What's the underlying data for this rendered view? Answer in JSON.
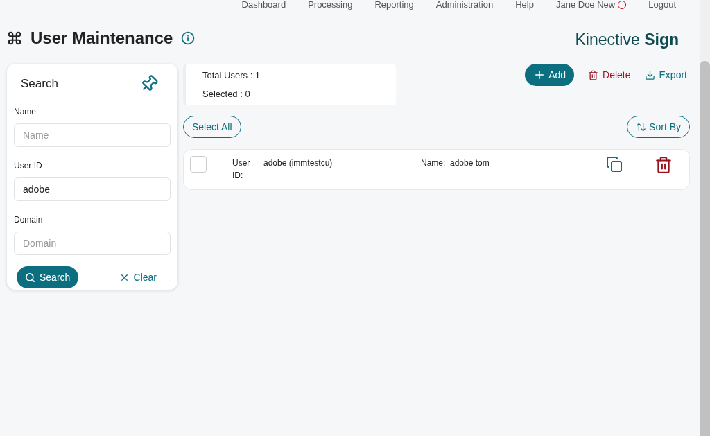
{
  "nav": [
    {
      "label": "Dashboard"
    },
    {
      "label": "Processing"
    },
    {
      "label": "Reporting"
    },
    {
      "label": "Administration"
    },
    {
      "label": "Help"
    },
    {
      "label": "Jane Doe New",
      "alert": true
    },
    {
      "label": "Logout"
    }
  ],
  "page": {
    "title": "User Maintenance"
  },
  "brand": {
    "light": "Kinective",
    "bold": "Sign"
  },
  "search": {
    "title": "Search",
    "fields": [
      {
        "label": "Name",
        "placeholder": "Name"
      },
      {
        "label": "User ID",
        "value": "adobe"
      },
      {
        "label": "Domain",
        "placeholder": "Domain"
      }
    ],
    "search_button": "Search",
    "clear_button": "Clear"
  },
  "summary": {
    "total": "Total Users : 1",
    "selected": "Selected : 0"
  },
  "actions": {
    "add": "Add",
    "delete": "Delete",
    "export": "Export"
  },
  "select_all": "Select All",
  "sort_by": "Sort By",
  "rows": [
    {
      "checked": false,
      "user_id_label": "User ID:",
      "user_id": "adobe (immtestcu)",
      "name_label": "Name:",
      "name": "adobe tom"
    }
  ]
}
